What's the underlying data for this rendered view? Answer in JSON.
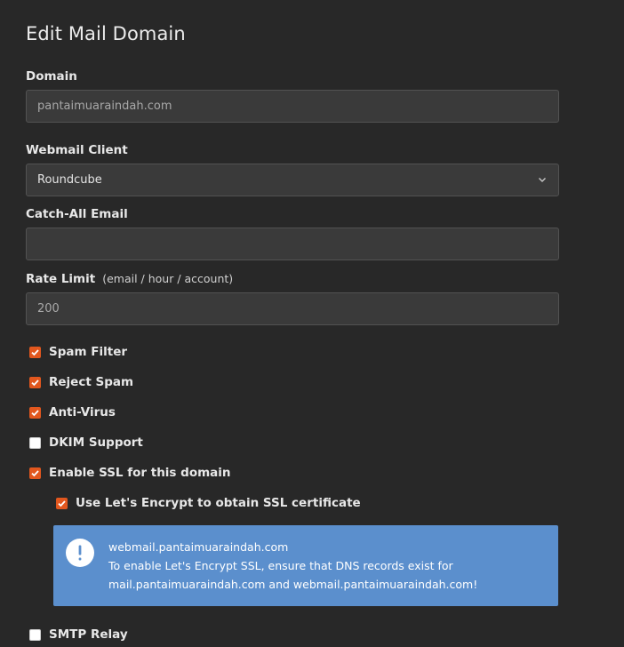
{
  "page": {
    "title": "Edit Mail Domain"
  },
  "domain": {
    "label": "Domain",
    "value": "pantaimuaraindah.com"
  },
  "webmail": {
    "label": "Webmail Client",
    "selected": "Roundcube"
  },
  "catch_all": {
    "label": "Catch-All Email",
    "value": ""
  },
  "rate_limit": {
    "label": "Rate Limit",
    "hint": "(email / hour / account)",
    "value": "200"
  },
  "options": {
    "spam_filter": {
      "label": "Spam Filter",
      "checked": true
    },
    "reject_spam": {
      "label": "Reject Spam",
      "checked": true
    },
    "anti_virus": {
      "label": "Anti-Virus",
      "checked": true
    },
    "dkim": {
      "label": "DKIM Support",
      "checked": false
    },
    "ssl": {
      "label": "Enable SSL for this domain",
      "checked": true
    },
    "letsencrypt": {
      "label": "Use Let's Encrypt to obtain SSL certificate",
      "checked": true
    },
    "smtp_relay": {
      "label": "SMTP Relay",
      "checked": false
    }
  },
  "alert": {
    "icon": "exclamation-circle-icon",
    "line1": "webmail.pantaimuaraindah.com",
    "line2": "To enable Let's Encrypt SSL, ensure that DNS records exist for",
    "line3": "mail.pantaimuaraindah.com and webmail.pantaimuaraindah.com!"
  },
  "colors": {
    "background": "#282828",
    "checkbox_accent": "#e2571e",
    "alert_background": "#5b8fcd"
  }
}
